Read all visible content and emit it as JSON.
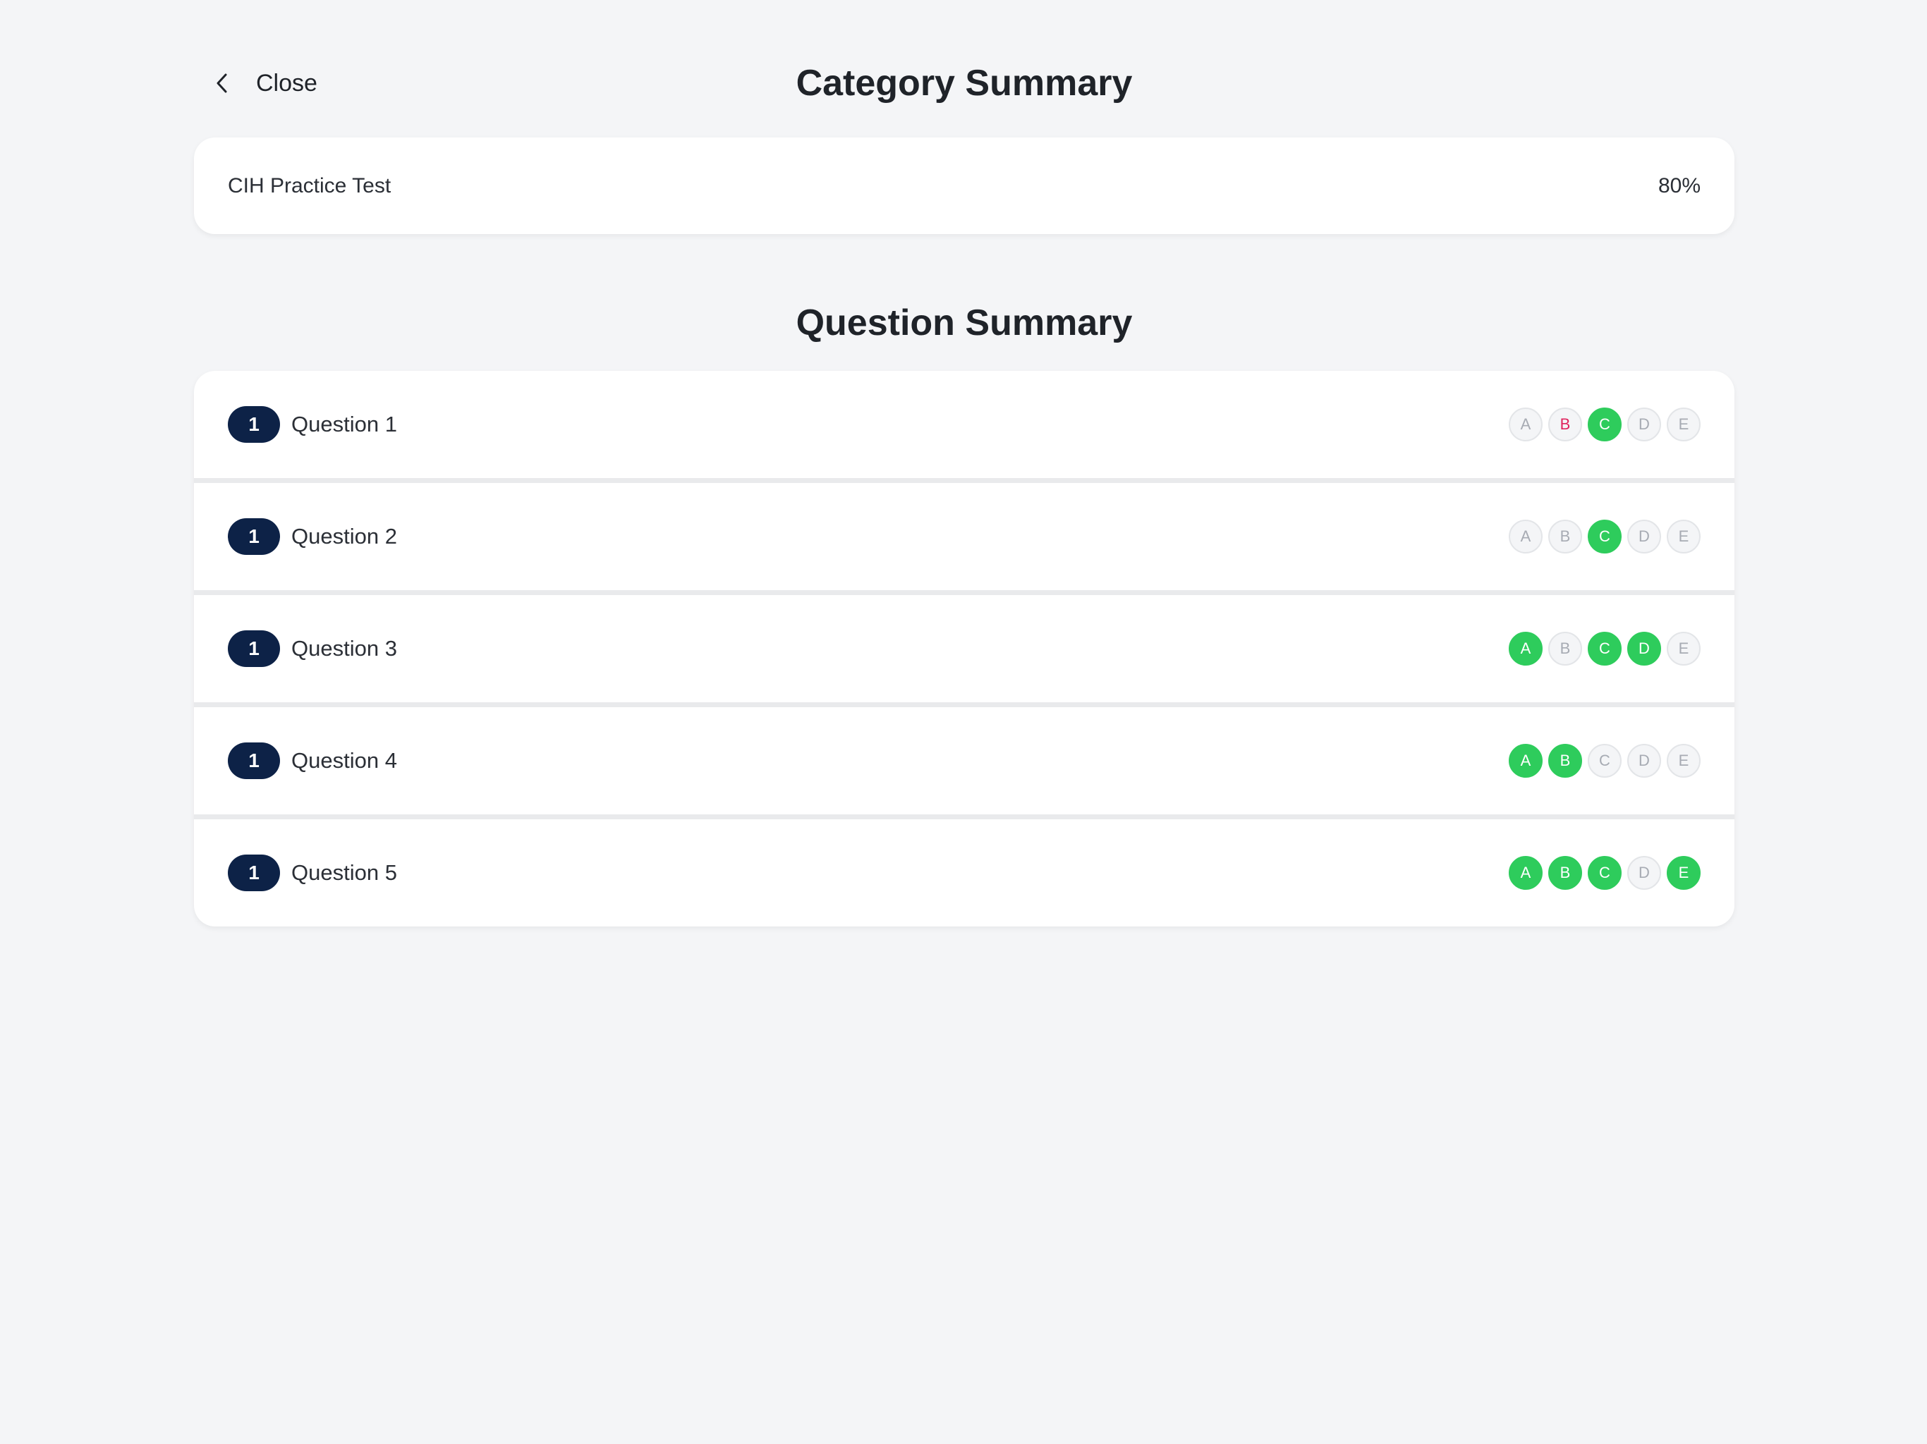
{
  "header": {
    "close_label": "Close",
    "close_icon": "chevron-left-icon",
    "title": "Category Summary"
  },
  "summary": {
    "test_name": "CIH Practice Test",
    "score": "80%"
  },
  "question_summary_title": "Question Summary",
  "colors": {
    "correct": "#2ecc5c",
    "wrong": "#e0245e",
    "neutral": "#a7abb3",
    "pill": "#0d2247",
    "background": "#f4f5f7"
  },
  "questions": [
    {
      "number": "1",
      "label": "Question 1",
      "options": [
        {
          "letter": "A",
          "state": "neutral"
        },
        {
          "letter": "B",
          "state": "wrong"
        },
        {
          "letter": "C",
          "state": "correct"
        },
        {
          "letter": "D",
          "state": "neutral"
        },
        {
          "letter": "E",
          "state": "neutral"
        }
      ]
    },
    {
      "number": "1",
      "label": "Question 2",
      "options": [
        {
          "letter": "A",
          "state": "neutral"
        },
        {
          "letter": "B",
          "state": "neutral"
        },
        {
          "letter": "C",
          "state": "correct"
        },
        {
          "letter": "D",
          "state": "neutral"
        },
        {
          "letter": "E",
          "state": "neutral"
        }
      ]
    },
    {
      "number": "1",
      "label": "Question 3",
      "options": [
        {
          "letter": "A",
          "state": "correct"
        },
        {
          "letter": "B",
          "state": "neutral"
        },
        {
          "letter": "C",
          "state": "correct"
        },
        {
          "letter": "D",
          "state": "correct"
        },
        {
          "letter": "E",
          "state": "neutral"
        }
      ]
    },
    {
      "number": "1",
      "label": "Question 4",
      "options": [
        {
          "letter": "A",
          "state": "correct"
        },
        {
          "letter": "B",
          "state": "correct"
        },
        {
          "letter": "C",
          "state": "neutral"
        },
        {
          "letter": "D",
          "state": "neutral"
        },
        {
          "letter": "E",
          "state": "neutral"
        }
      ]
    },
    {
      "number": "1",
      "label": "Question 5",
      "options": [
        {
          "letter": "A",
          "state": "correct"
        },
        {
          "letter": "B",
          "state": "correct"
        },
        {
          "letter": "C",
          "state": "correct"
        },
        {
          "letter": "D",
          "state": "neutral"
        },
        {
          "letter": "E",
          "state": "correct"
        }
      ]
    }
  ]
}
